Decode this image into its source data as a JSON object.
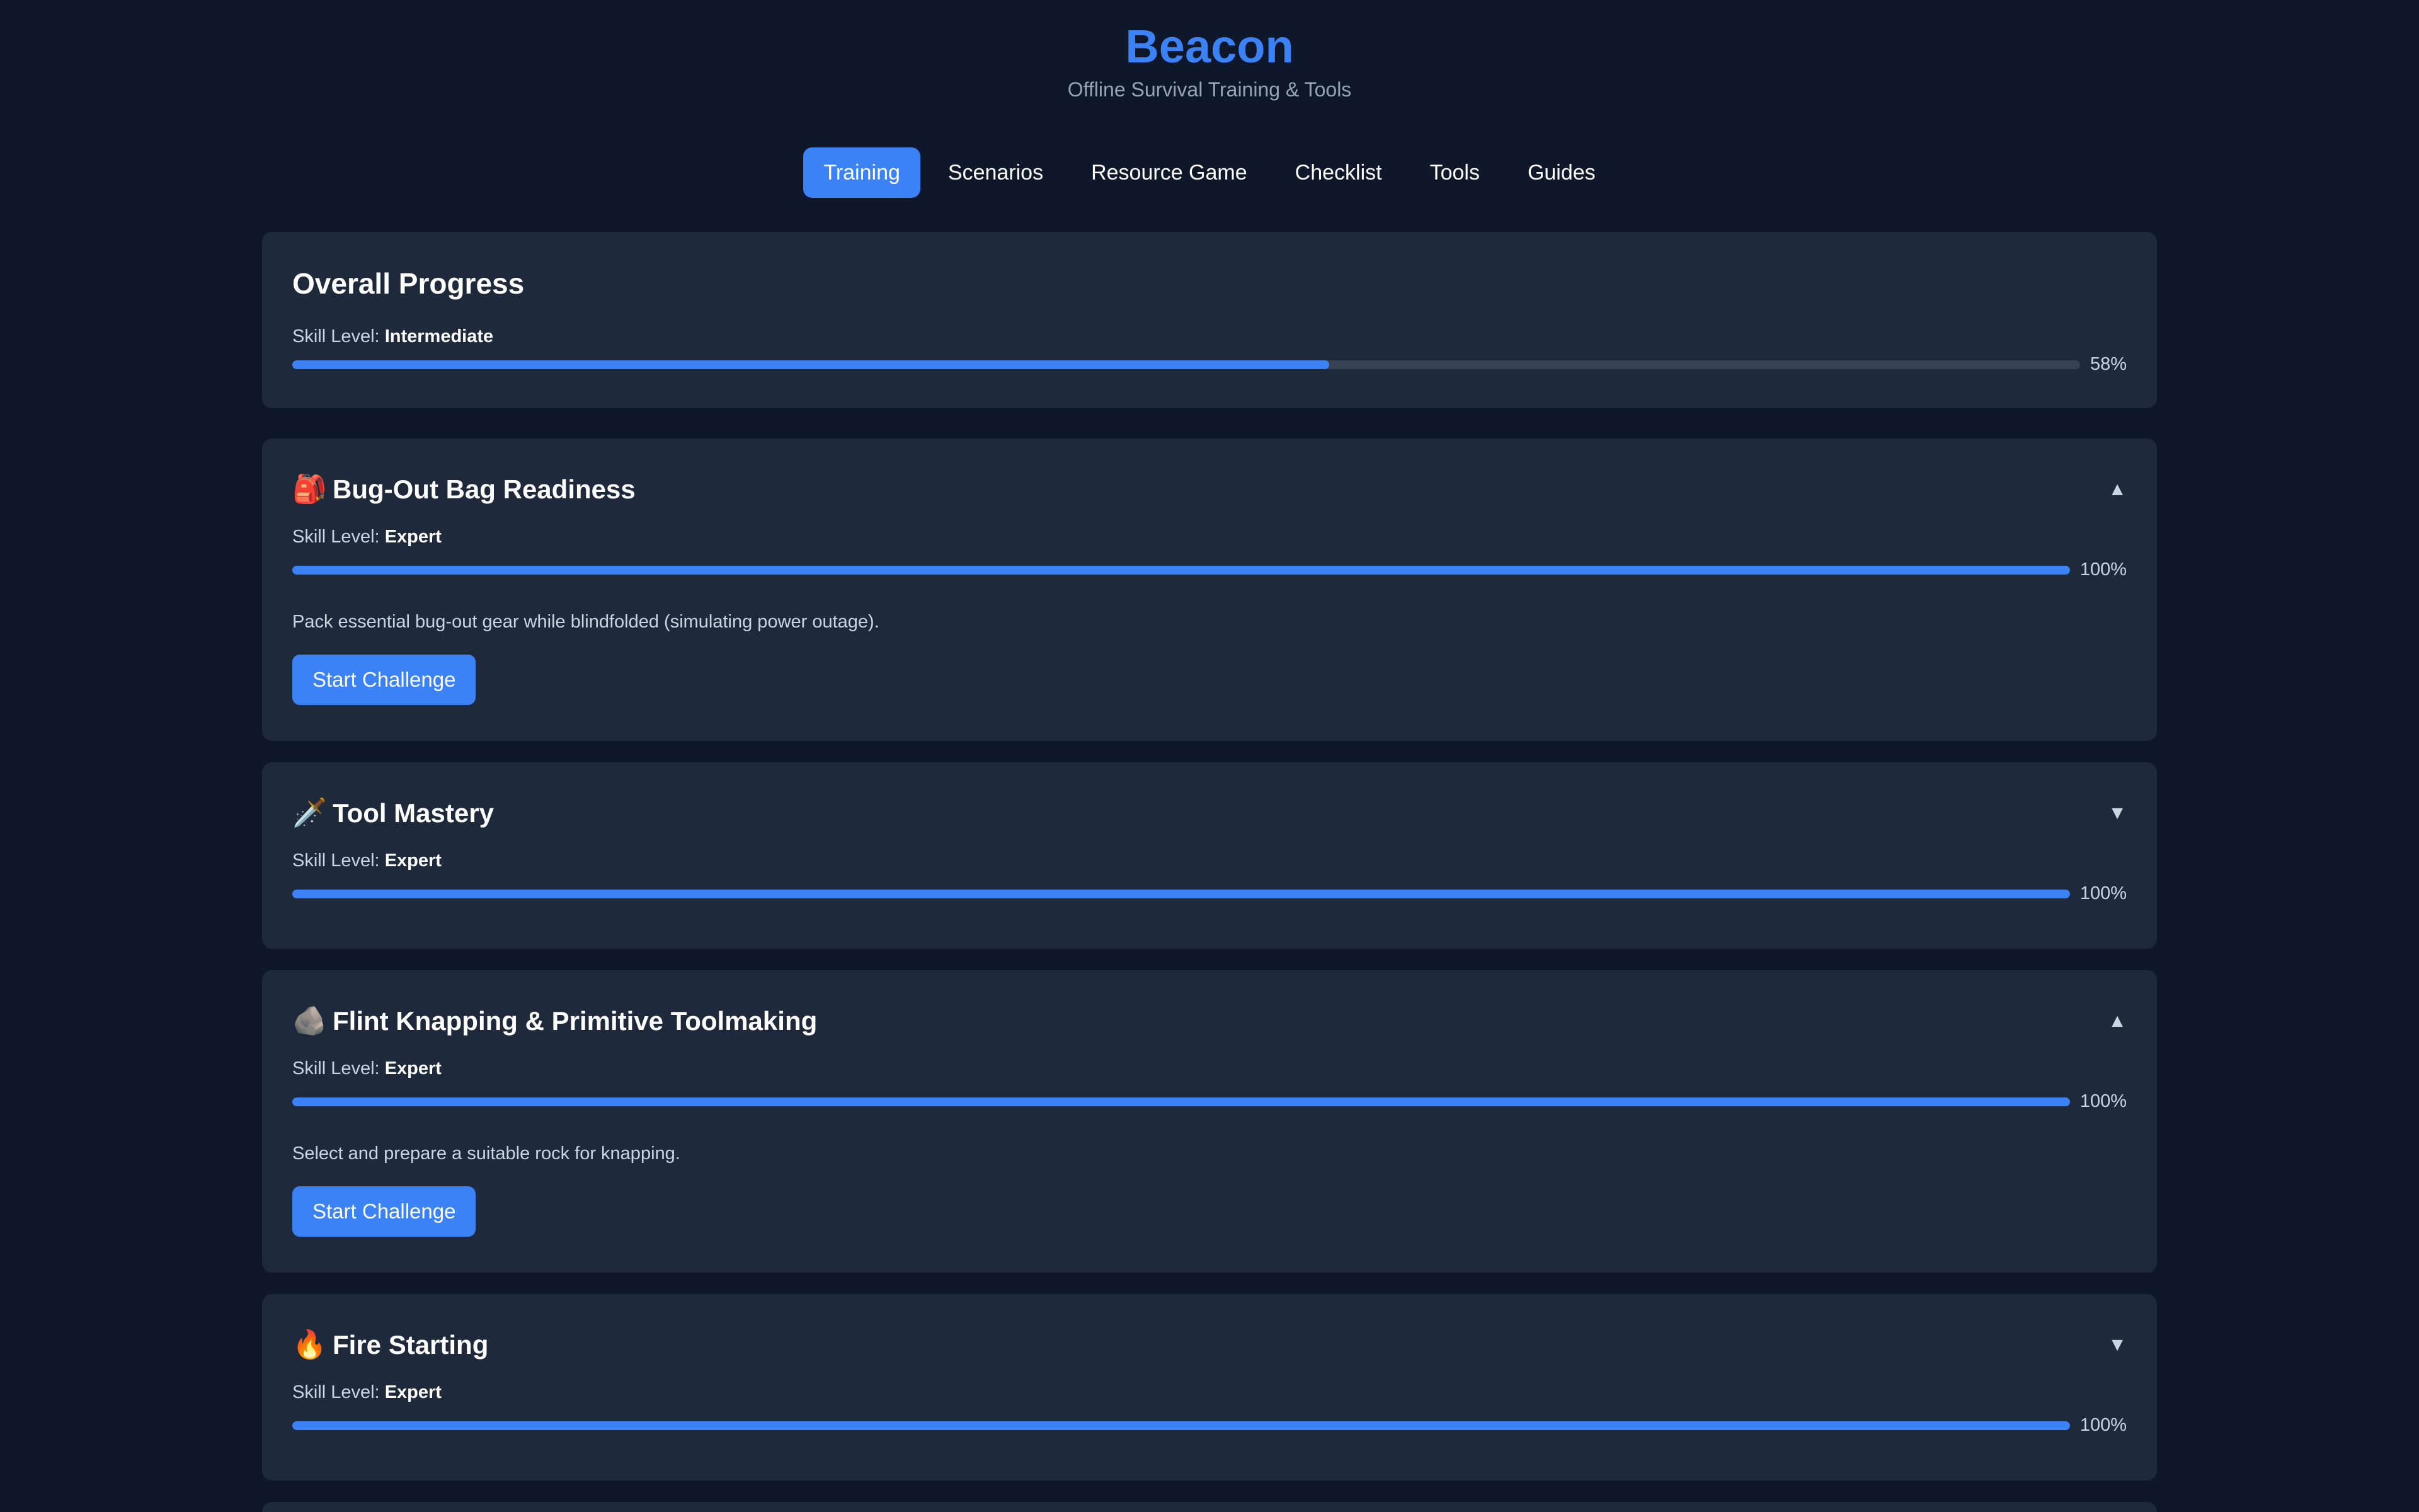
{
  "app": {
    "title": "Beacon",
    "subtitle": "Offline Survival Training & Tools"
  },
  "tabs": [
    {
      "label": "Training",
      "active": true
    },
    {
      "label": "Scenarios",
      "active": false
    },
    {
      "label": "Resource Game",
      "active": false
    },
    {
      "label": "Checklist",
      "active": false
    },
    {
      "label": "Tools",
      "active": false
    },
    {
      "label": "Guides",
      "active": false
    }
  ],
  "overall": {
    "title": "Overall Progress",
    "skill_prefix": "Skill Level:",
    "skill_level": "Intermediate",
    "progress": 58,
    "progress_label": "58%"
  },
  "modules": [
    {
      "icon": "🎒",
      "icon_name": "backpack-icon",
      "title": "Bug-Out Bag Readiness",
      "expanded": true,
      "chevron": "▲",
      "skill_prefix": "Skill Level:",
      "skill_level": "Expert",
      "progress": 100,
      "progress_label": "100%",
      "description": "Pack essential bug-out gear while blindfolded (simulating power outage).",
      "button_label": "Start Challenge"
    },
    {
      "icon": "🗡️",
      "icon_name": "dagger-icon",
      "title": "Tool Mastery",
      "expanded": false,
      "chevron": "▼",
      "skill_prefix": "Skill Level:",
      "skill_level": "Expert",
      "progress": 100,
      "progress_label": "100%"
    },
    {
      "icon": "🪨",
      "icon_name": "rock-icon",
      "title": "Flint Knapping & Primitive Toolmaking",
      "expanded": true,
      "chevron": "▲",
      "skill_prefix": "Skill Level:",
      "skill_level": "Expert",
      "progress": 100,
      "progress_label": "100%",
      "description": "Select and prepare a suitable rock for knapping.",
      "button_label": "Start Challenge"
    },
    {
      "icon": "🔥",
      "icon_name": "fire-icon",
      "title": "Fire Starting",
      "expanded": false,
      "chevron": "▼",
      "skill_prefix": "Skill Level:",
      "skill_level": "Expert",
      "progress": 100,
      "progress_label": "100%"
    }
  ],
  "colors": {
    "background": "#0f172a",
    "card": "#1e293b",
    "accent": "#3b82f6",
    "track": "#374151"
  }
}
